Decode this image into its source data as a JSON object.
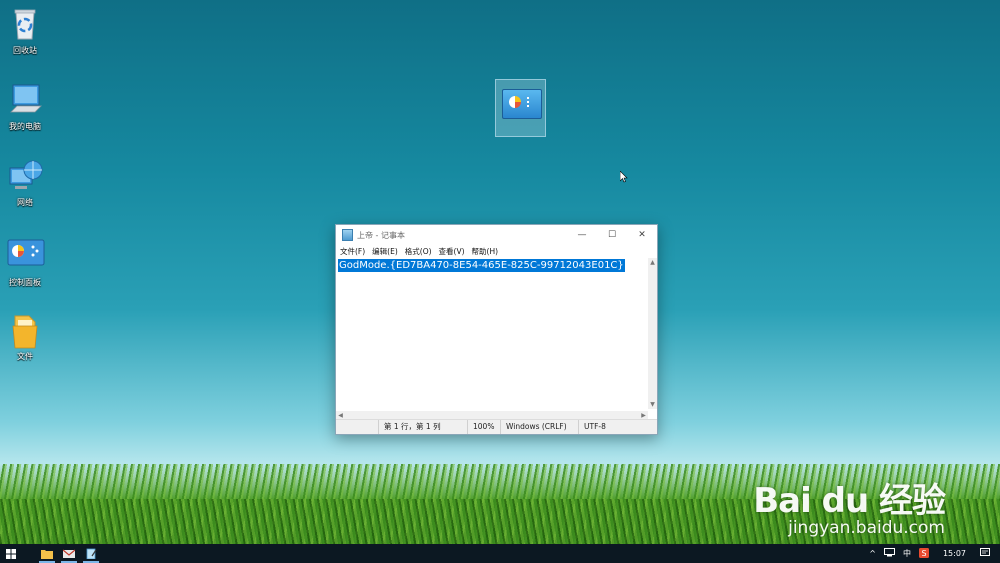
{
  "desktop": {
    "icons": [
      {
        "label": "回收站"
      },
      {
        "label": "我的电脑"
      },
      {
        "label": "网络"
      },
      {
        "label": "控制面板"
      },
      {
        "label": "文件"
      }
    ]
  },
  "notepad": {
    "title": "上帝 - 记事本",
    "menu": [
      "文件(F)",
      "编辑(E)",
      "格式(O)",
      "查看(V)",
      "帮助(H)"
    ],
    "content": "GodMode.{ED7BA470-8E54-465E-825C-99712043E01C}",
    "status": {
      "position": "第 1 行，第 1 列",
      "zoom": "100%",
      "line_ending": "Windows (CRLF)",
      "encoding": "UTF-8"
    }
  },
  "taskbar": {
    "tray_caret": "^",
    "ime": "中",
    "clock": "15:07"
  },
  "watermark": {
    "brand": "Bai du 经验",
    "url": "jingyan.baidu.com"
  },
  "colors": {
    "selection": "#0078d7",
    "taskbar": "#0c1822"
  }
}
